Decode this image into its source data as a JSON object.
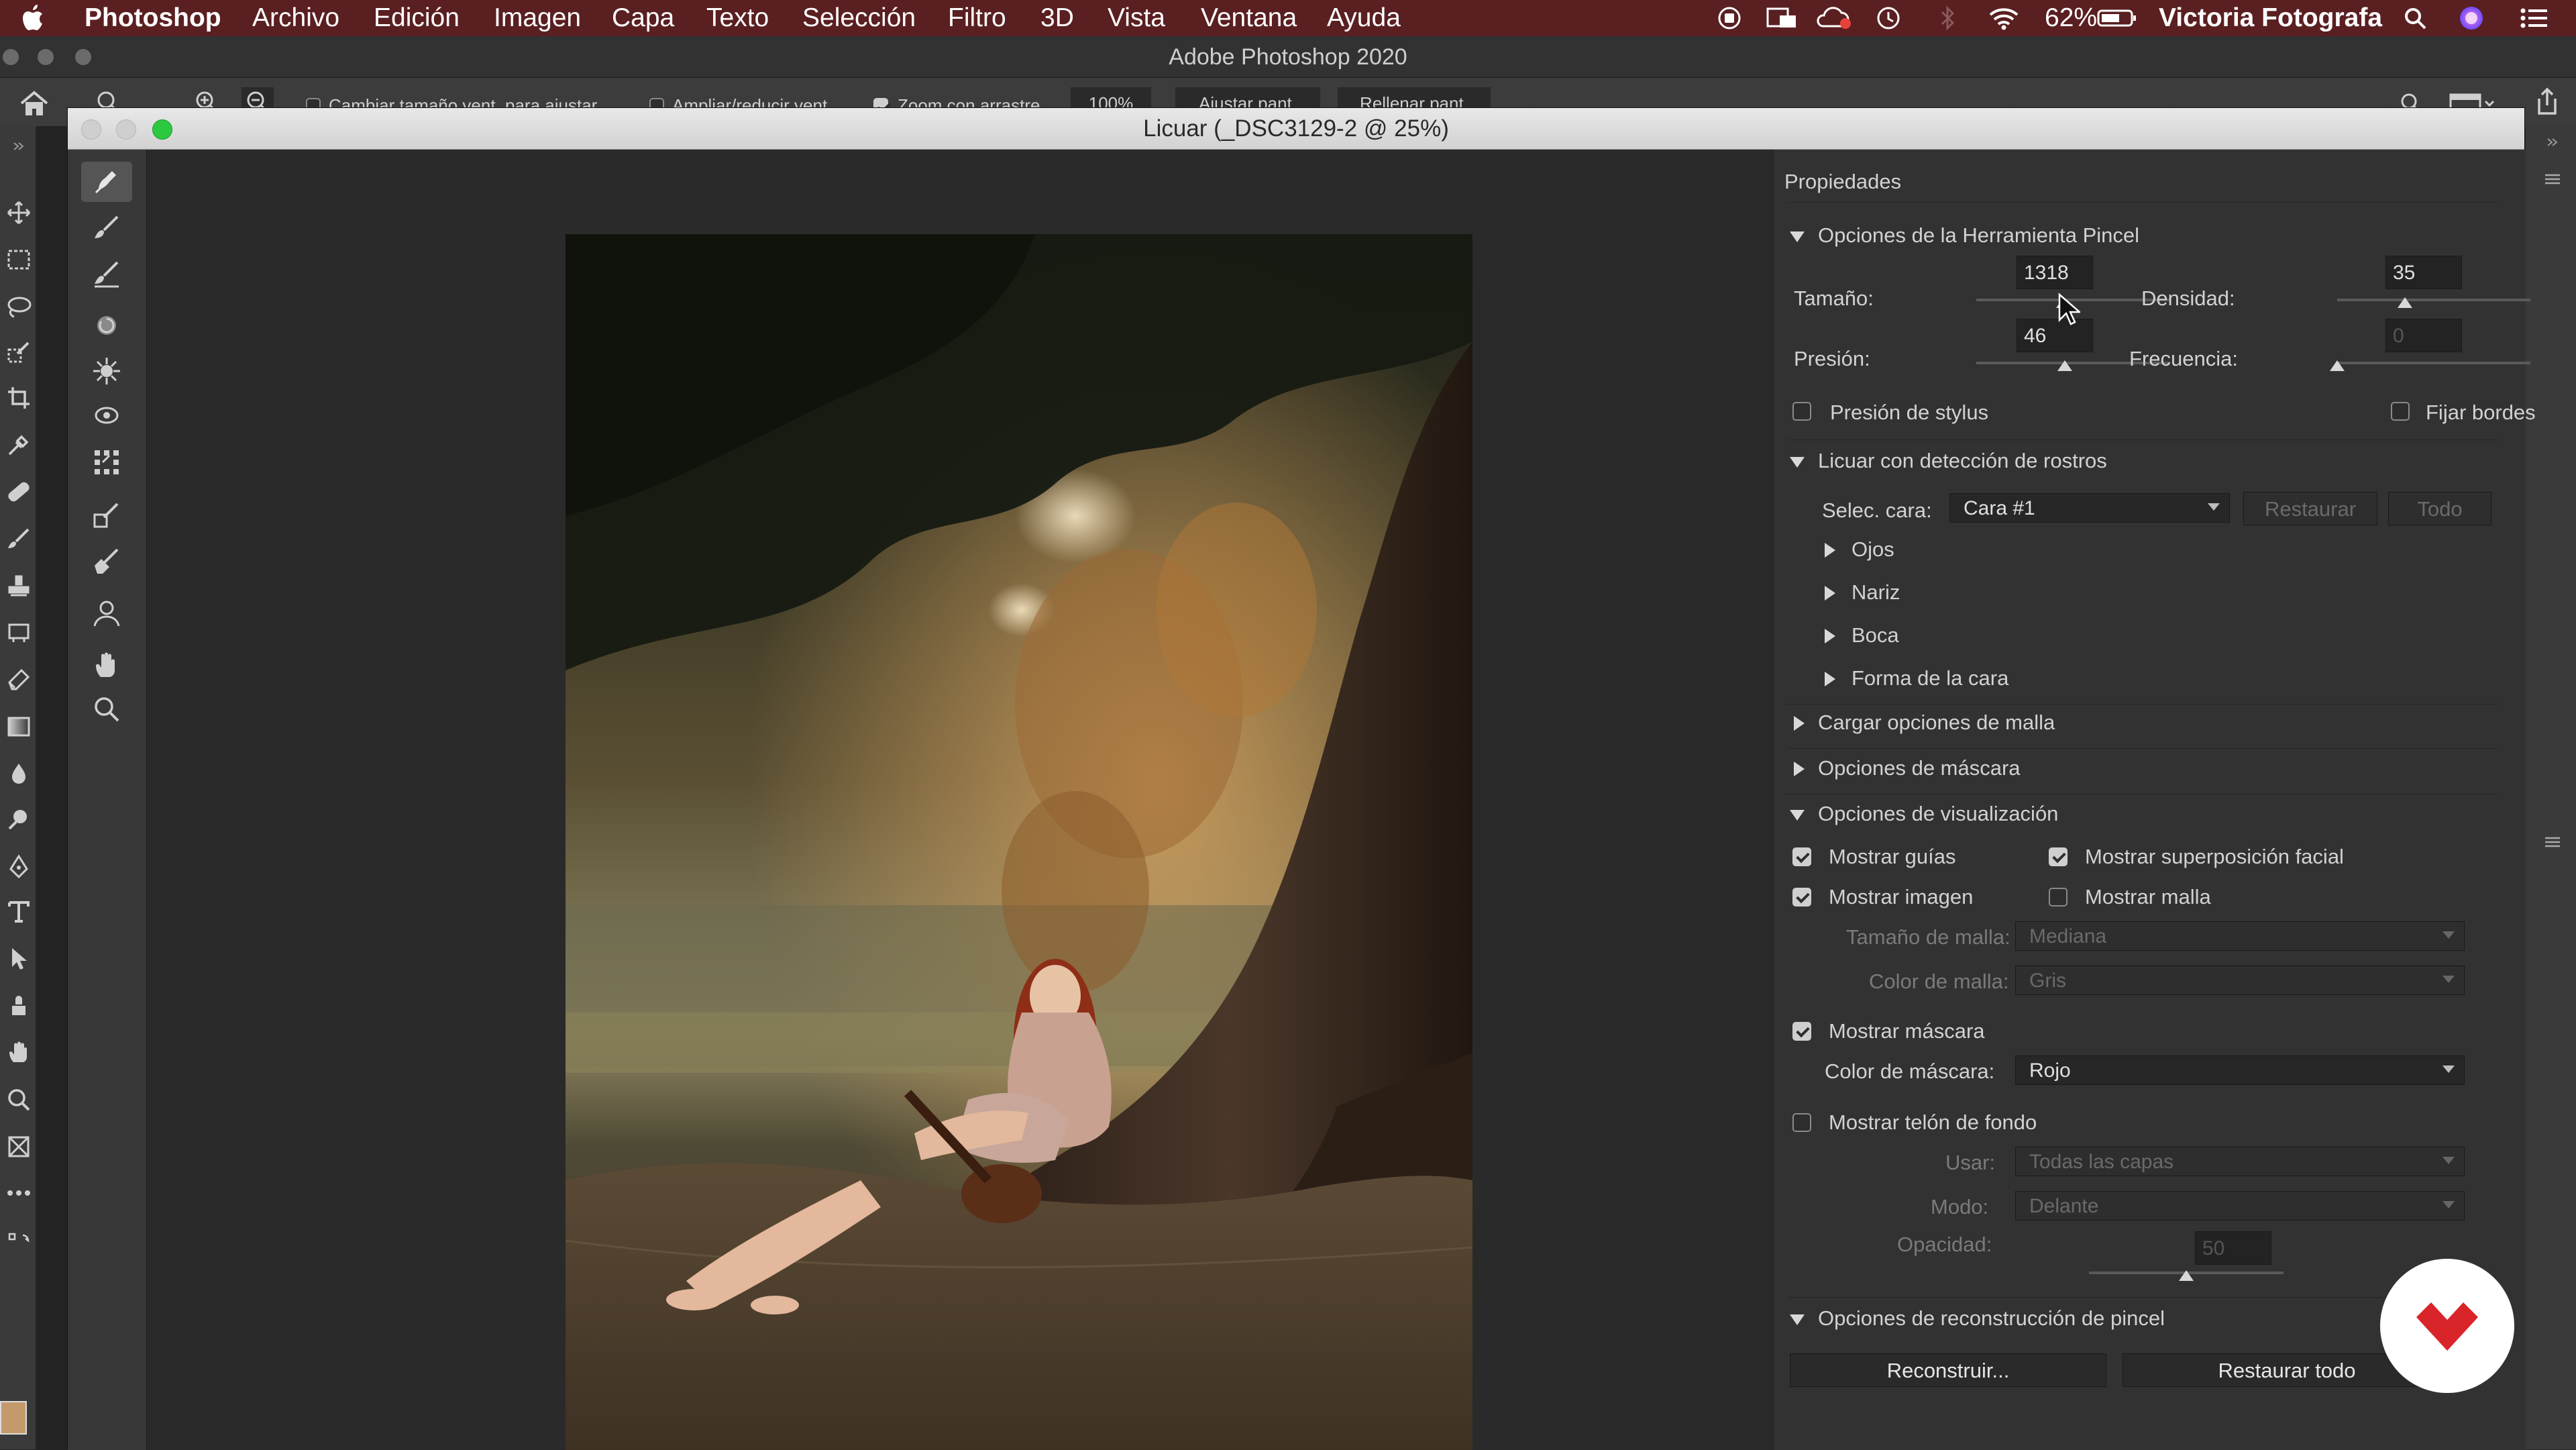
{
  "menubar": {
    "app_name": "Photoshop",
    "items": [
      "Archivo",
      "Edición",
      "Imagen",
      "Capa",
      "Texto",
      "Selección",
      "Filtro",
      "3D",
      "Vista",
      "Ventana",
      "Ayuda"
    ],
    "battery": "62%",
    "user": "Victoria Fotografa"
  },
  "app": {
    "title": "Adobe Photoshop 2020"
  },
  "optbar": {
    "resize_windows": "Cambiar tamaño vent. para ajustar",
    "zoom_all": "Ampliar/reducir vent.",
    "scrubby": "Zoom con arrastre",
    "zoom": "100%",
    "fit": "Ajustar pant.",
    "fill": "Rellenar pant."
  },
  "liquify": {
    "title": "Licuar (_DSC3129-2 @ 25%)"
  },
  "props": {
    "title": "Propiedades",
    "brush": {
      "header": "Opciones de la Herramienta Pincel",
      "size_label": "Tamaño:",
      "size_value": "1318",
      "density_label": "Densidad:",
      "density_value": "35",
      "pressure_label": "Presión:",
      "pressure_value": "46",
      "rate_label": "Frecuencia:",
      "rate_value": "0",
      "stylus_label": "Presión de stylus",
      "pin_label": "Fijar bordes",
      "slider_size": 0.45,
      "slider_density": 0.35,
      "slider_pressure": 0.46,
      "slider_rate": 0.0
    },
    "face": {
      "header": "Licuar con detección de rostros",
      "select_label": "Selec. cara:",
      "select_value": "Cara #1",
      "reset": "Restaurar",
      "all": "Todo",
      "items": [
        "Ojos",
        "Nariz",
        "Boca",
        "Forma de la cara"
      ]
    },
    "load_mesh": "Cargar opciones de malla",
    "mask": "Opciones de máscara",
    "view": {
      "header": "Opciones de visualización",
      "show_guides": "Mostrar guías",
      "face_overlay": "Mostrar superposición facial",
      "show_image": "Mostrar imagen",
      "show_mesh": "Mostrar malla",
      "mesh_size_label": "Tamaño de malla:",
      "mesh_size_value": "Mediana",
      "mesh_color_label": "Color de malla:",
      "mesh_color_value": "Gris",
      "show_mask": "Mostrar máscara",
      "mask_color_label": "Color de máscara:",
      "mask_color_value": "Rojo",
      "backdrop": "Mostrar telón de fondo",
      "use_label": "Usar:",
      "use_value": "Todas las capas",
      "mode_label": "Modo:",
      "mode_value": "Delante",
      "opacity_label": "Opacidad:",
      "opacity_value": "50",
      "slider_opacity": 0.5
    },
    "reconstruct": {
      "header": "Opciones de reconstrucción de pincel",
      "reconstruct_btn": "Reconstruir...",
      "restore_all_btn": "Restaurar todo"
    }
  }
}
